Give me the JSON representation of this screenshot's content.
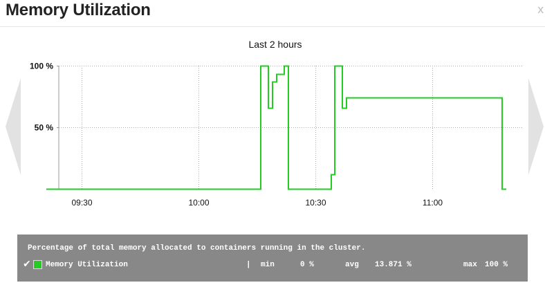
{
  "window": {
    "title": "Memory Utilization",
    "close_label": "x"
  },
  "nav": {
    "prev_icon": "chevron-left-icon",
    "next_icon": "chevron-right-icon"
  },
  "chart_data": {
    "type": "line",
    "title": "Last 2 hours",
    "xlabel": "",
    "ylabel": "",
    "x_ticks": [
      "09:30",
      "10:00",
      "10:30",
      "11:00"
    ],
    "y_ticks": [
      "100 %",
      "50 %"
    ],
    "ylim": [
      0,
      100
    ],
    "xlim": [
      "09:20",
      "11:30"
    ],
    "grid": "dotted vertical and horizontal",
    "series": [
      {
        "name": "Memory Utilization",
        "color": "#22cc22",
        "step": true,
        "points": [
          [
            "09:21",
            0
          ],
          [
            "10:16",
            0
          ],
          [
            "10:16",
            100
          ],
          [
            "10:18",
            100
          ],
          [
            "10:18",
            66
          ],
          [
            "10:19",
            66
          ],
          [
            "10:19",
            87
          ],
          [
            "10:20",
            87
          ],
          [
            "10:20",
            93
          ],
          [
            "10:22",
            93
          ],
          [
            "10:22",
            100
          ],
          [
            "10:23",
            100
          ],
          [
            "10:23",
            0
          ],
          [
            "10:34",
            0
          ],
          [
            "10:34",
            12
          ],
          [
            "10:35",
            12
          ],
          [
            "10:35",
            100
          ],
          [
            "10:37",
            100
          ],
          [
            "10:37",
            66
          ],
          [
            "10:38",
            66
          ],
          [
            "10:38",
            74
          ],
          [
            "11:18",
            74
          ],
          [
            "11:18",
            0
          ],
          [
            "11:19",
            0
          ]
        ]
      }
    ]
  },
  "legend": {
    "description": "Percentage of total memory allocated to containers running in the cluster.",
    "check_icon": "✔",
    "series_label": "Memory Utilization",
    "separator": "|",
    "min_label": "min",
    "min_value": "0 %",
    "avg_label": "avg",
    "avg_value": "13.871 %",
    "max_label": "max",
    "max_value": "100 %"
  }
}
